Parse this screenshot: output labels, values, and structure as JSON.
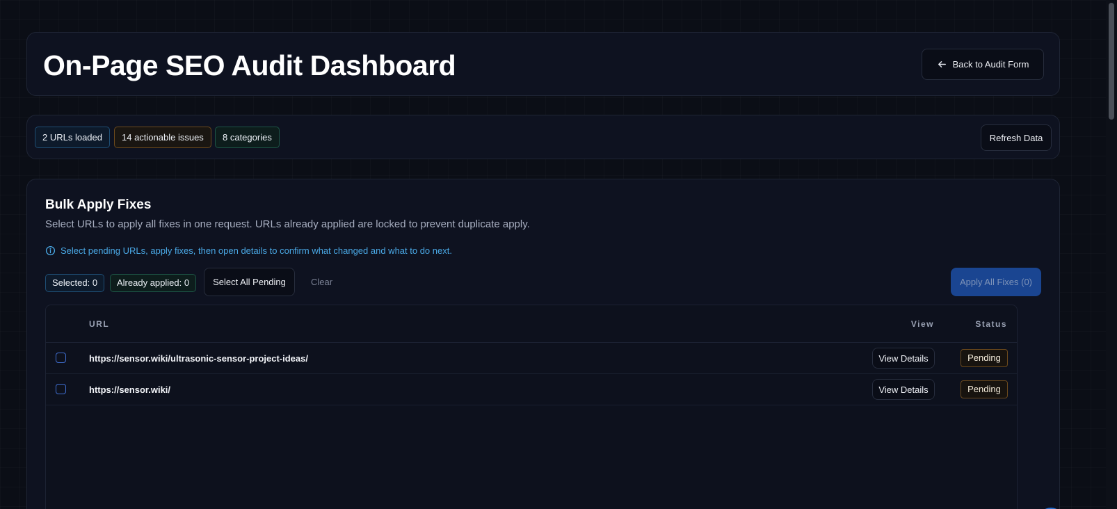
{
  "header": {
    "title": "On-Page SEO Audit Dashboard",
    "back_label": "Back to Audit Form"
  },
  "stats": {
    "urls_loaded": "2 URLs loaded",
    "actionable_issues": "14 actionable issues",
    "categories": "8 categories",
    "refresh_label": "Refresh Data"
  },
  "bulk": {
    "title": "Bulk Apply Fixes",
    "description": "Select URLs to apply all fixes in one request. URLs already applied are locked to prevent duplicate apply.",
    "hint": "Select pending URLs, apply fixes, then open details to confirm what changed and what to do next.",
    "selected_label": "Selected: 0",
    "applied_label": "Already applied: 0",
    "select_all_label": "Select All Pending",
    "clear_label": "Clear",
    "apply_label": "Apply All Fixes (0)"
  },
  "table": {
    "columns": {
      "url": "URL",
      "view": "View",
      "status": "Status"
    },
    "rows": [
      {
        "url": "https://sensor.wiki/ultrasonic-sensor-project-ideas/",
        "view_label": "View Details",
        "status": "Pending"
      },
      {
        "url": "https://sensor.wiki/",
        "view_label": "View Details",
        "status": "Pending"
      }
    ]
  },
  "colors": {
    "background": "#0b0e16",
    "card": "#0e1220",
    "accent_blue": "#1a4591",
    "hint_blue": "#4aa9e6",
    "pending_border": "#6c4a1c"
  },
  "icons": {
    "back": "arrow-left-icon",
    "info": "info-circle-icon"
  }
}
